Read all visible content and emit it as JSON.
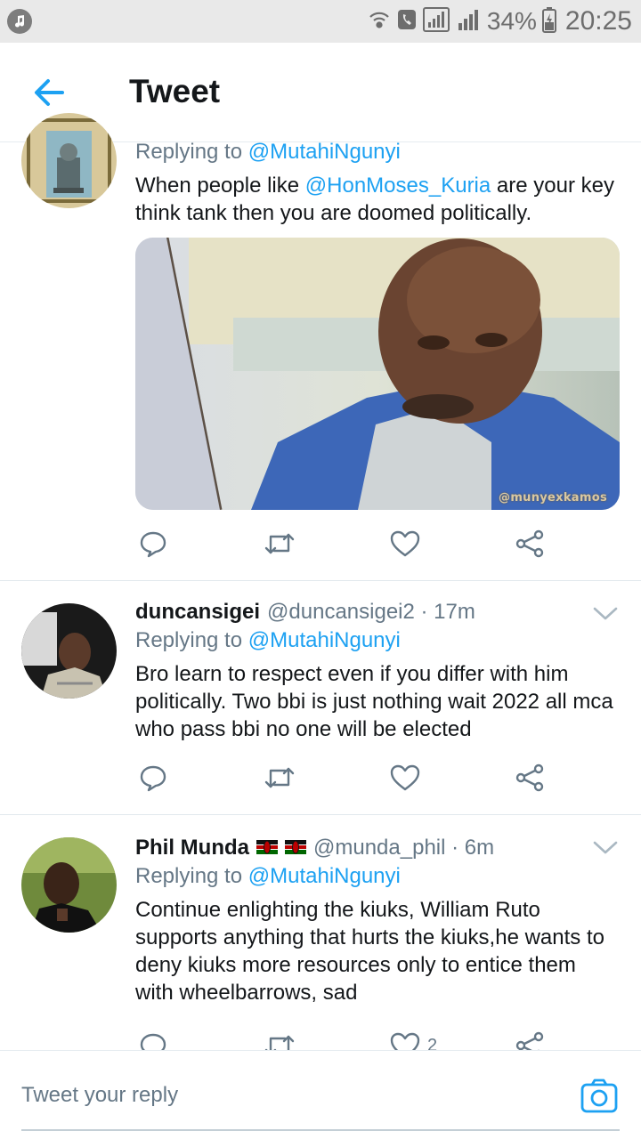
{
  "status_bar": {
    "battery": "34%",
    "time": "20:25"
  },
  "header": {
    "title": "Tweet"
  },
  "tweets": [
    {
      "reply_prefix": "Replying to",
      "reply_to": "@MutahiNgunyi",
      "text_before": "When people like ",
      "mention": "@HonMoses_Kuria",
      "text_after": " are your key think tank then you are doomed politically.",
      "media_watermark": "@munyexkamos"
    },
    {
      "name": "duncansigei",
      "handle": "@duncansigei2 · 17m",
      "reply_prefix": "Replying to",
      "reply_to": "@MutahiNgunyi",
      "text": "Bro learn to respect even if you differ with him politically. Two bbi is just nothing wait 2022 all mca who pass bbi no one will be elected"
    },
    {
      "name": "Phil Munda",
      "handle": "@munda_phil · 6m",
      "reply_prefix": "Replying to",
      "reply_to": "@MutahiNgunyi",
      "text": "Continue enlighting the kiuks, William Ruto supports anything that hurts the kiuks,he wants to deny kiuks more resources only to entice them with wheelbarrows, sad",
      "like_count": "2"
    }
  ],
  "compose": {
    "placeholder": "Tweet your reply"
  },
  "colors": {
    "accent": "#1da1f2",
    "text": "#14171a",
    "secondary": "#657786"
  }
}
